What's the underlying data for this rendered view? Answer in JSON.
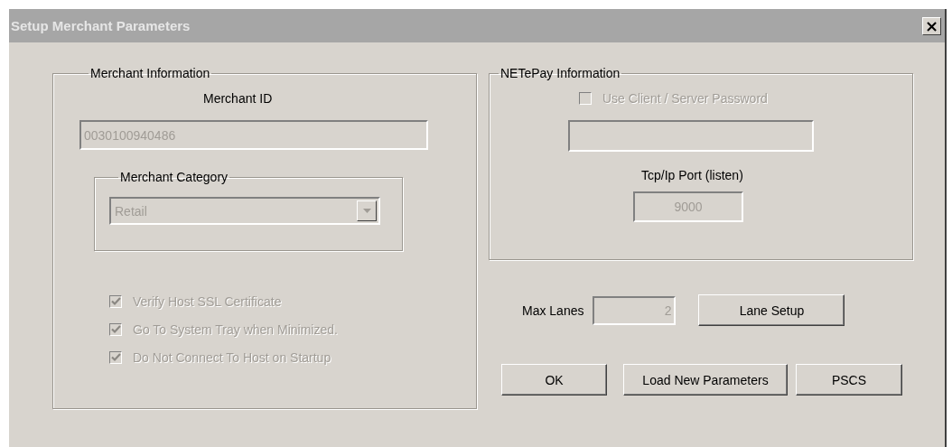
{
  "window": {
    "title": "Setup Merchant Parameters",
    "close": "×"
  },
  "merchant_information": {
    "legend": "Merchant Information",
    "merchant_id_label": "Merchant ID",
    "merchant_id": {
      "value": "0030100940486",
      "disabled": true
    },
    "merchant_category": {
      "legend": "Merchant Category",
      "value": "Retail",
      "disabled": true
    },
    "options": [
      {
        "label": "Verify Host SSL Certificate",
        "checked": true,
        "disabled": true
      },
      {
        "label": "Go To System Tray when Minimized.",
        "checked": true,
        "disabled": true
      },
      {
        "label": "Do Not Connect To Host on Startup",
        "checked": true,
        "disabled": true
      }
    ]
  },
  "netepay_information": {
    "legend": "NETePay Information",
    "use_password": {
      "label": "Use Client / Server Password",
      "checked": false,
      "disabled": true
    },
    "password": {
      "disabled": true
    },
    "port_label": "Tcp/Ip Port (listen)",
    "port": {
      "value": "9000",
      "disabled": true
    }
  },
  "max_lanes": {
    "label": "Max Lanes",
    "value": "2",
    "disabled": true
  },
  "lane_setup_button": "Lane Setup",
  "buttons": [
    "OK",
    "Load New Parameters",
    "PSCS"
  ]
}
